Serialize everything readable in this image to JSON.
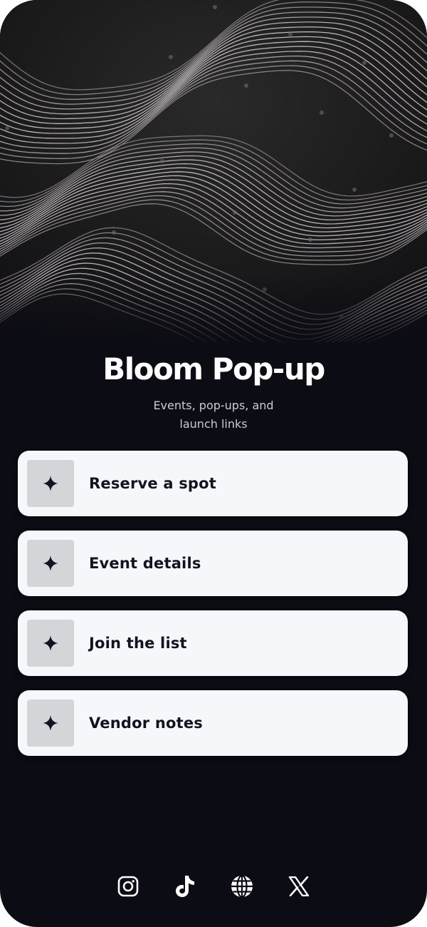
{
  "profile": {
    "title": "Bloom Pop-up",
    "subtitle": "Events, pop-ups, and launch links"
  },
  "links": [
    {
      "label": "Reserve a spot",
      "icon": "sparkle-icon"
    },
    {
      "label": "Event details",
      "icon": "sparkle-icon"
    },
    {
      "label": "Join the list",
      "icon": "sparkle-icon"
    },
    {
      "label": "Vendor notes",
      "icon": "sparkle-icon"
    }
  ],
  "socials": [
    {
      "icon": "instagram-icon"
    },
    {
      "icon": "tiktok-icon"
    },
    {
      "icon": "globe-icon"
    },
    {
      "icon": "x-icon"
    }
  ],
  "colors": {
    "background": "#0b0c14",
    "card": "#f6f7fa",
    "icon_tile": "#d4d5d9",
    "text_dark": "#111320",
    "text_light": "#ffffff",
    "subtitle": "#c9cbd6"
  }
}
